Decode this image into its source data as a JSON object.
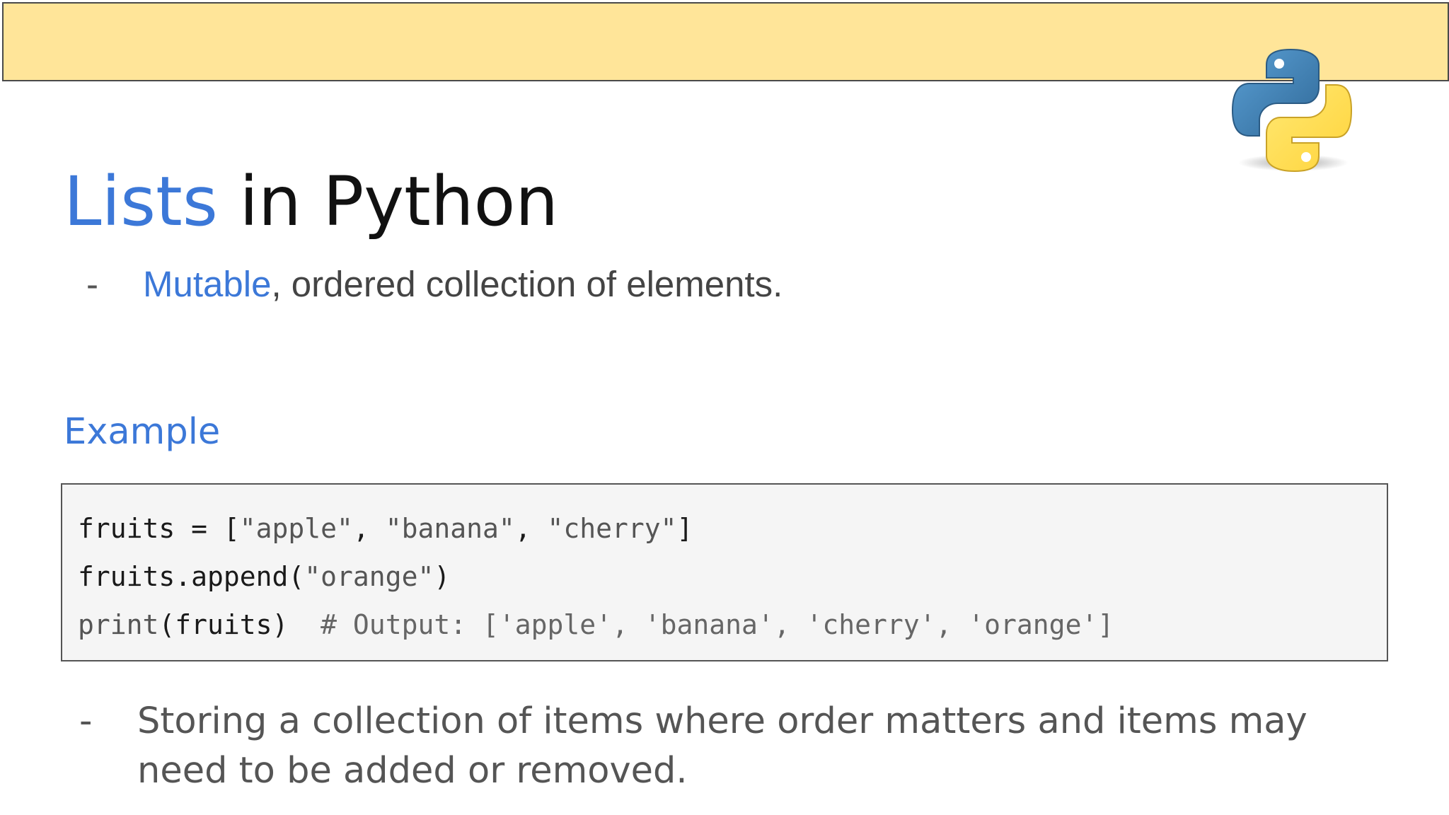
{
  "slide": {
    "title_accent": "Lists",
    "title_rest": " in Python",
    "bullet1": {
      "dash": "-",
      "accent": "Mutable",
      "rest": ", ordered collection of elements."
    },
    "example_heading": "Example",
    "code": {
      "line1": {
        "a": "fruits = [",
        "s1": "\"apple\"",
        "b": ", ",
        "s2": "\"banana\"",
        "c": ", ",
        "s3": "\"cherry\"",
        "d": "]"
      },
      "line2": {
        "a": "fruits.append(",
        "s1": "\"orange\"",
        "b": ")"
      },
      "line3": {
        "fn": "print",
        "a": "(fruits)",
        "comment": "  # Output: ['apple', 'banana', 'cherry', 'orange']"
      }
    },
    "bullet2": {
      "dash": "-",
      "text": "Storing a collection of items where order matters and items may need to be added or removed."
    }
  },
  "logo": {
    "icon": "python-logo-icon",
    "colors": {
      "blue": "#3d74a8",
      "yellow": "#fed142"
    }
  },
  "colors": {
    "banner": "#ffe599",
    "accent": "#3c78d8",
    "code_bg": "#f5f5f5"
  }
}
